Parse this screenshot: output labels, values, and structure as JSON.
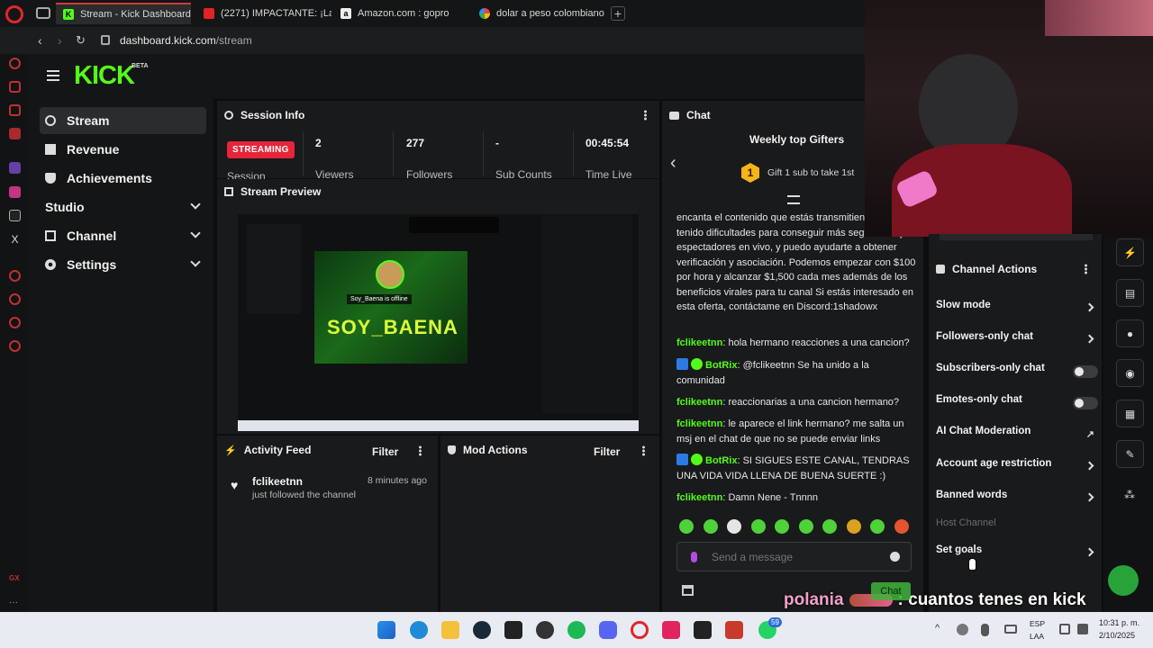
{
  "browser": {
    "tabs": [
      {
        "title": "Stream - Kick Dashboard",
        "active": true
      },
      {
        "title": "(2271) IMPACTANTE: ¡Las"
      },
      {
        "title": "Amazon.com : gopro"
      },
      {
        "title": "dolar a peso colombiano"
      }
    ],
    "url_domain": "dashboard.kick.com",
    "url_path": "/stream"
  },
  "brand": {
    "logo": "KICK",
    "tag": "BETA",
    "accent": "#53fc18"
  },
  "nav": {
    "items": [
      {
        "label": "Stream",
        "icon": "stream-icon"
      },
      {
        "label": "Revenue",
        "icon": "revenue-icon"
      },
      {
        "label": "Achievements",
        "icon": "trophy-icon"
      },
      {
        "label": "Studio",
        "icon": "studio-icon"
      },
      {
        "label": "Channel",
        "icon": "channel-icon"
      },
      {
        "label": "Settings",
        "icon": "gear-icon"
      }
    ]
  },
  "session": {
    "title": "Session Info",
    "badge": "STREAMING",
    "badge_sub": "Session",
    "stats": [
      {
        "value": "2",
        "label": "Viewers"
      },
      {
        "value": "277",
        "label": "Followers"
      },
      {
        "value": "-",
        "label": "Sub Counts"
      },
      {
        "value": "00:45:54",
        "label": "Time Live"
      }
    ]
  },
  "preview": {
    "title": "Stream Preview",
    "offline_text": "Soy_Baena is offline",
    "channel_art": "SOY_BAENA"
  },
  "activity": {
    "title": "Activity Feed",
    "filter": "Filter",
    "items": [
      {
        "user": "fclikeetnn",
        "action": "just followed the channel",
        "time": "8 minutes ago"
      }
    ]
  },
  "mod_actions": {
    "title": "Mod Actions",
    "filter": "Filter"
  },
  "chat": {
    "title": "Chat",
    "gifters_title": "Weekly top Gifters",
    "gifters_rank": "1",
    "gifters_cta": "Gift 1 sub to take 1st",
    "intro_text": "encanta el contenido que estás transmitiendo. Si has tenido dificultades para conseguir más seguidores y espectadores en vivo, y puedo ayudarte a obtener verificación y asociación. Podemos empezar con $100 por hora y alcanzar $1,500 cada mes además de los beneficios virales para tu canal Si estás interesado en esta oferta, contáctame en Discord:1shadowx",
    "messages": [
      {
        "user": "fclikeetnn",
        "text": "hola hermano reacciones a una cancion?"
      },
      {
        "user": "BotRix",
        "text": "@fclikeetnn Se ha unido a la comunidad",
        "bot": true
      },
      {
        "user": "fclikeetnn",
        "text": "reaccionarias a una cancion hermano?"
      },
      {
        "user": "fclikeetnn",
        "text": "le aparece el link hermano? me salta un msj en el chat de que no se puede enviar links"
      },
      {
        "user": "BotRix",
        "text": "SI SIGUES ESTE CANAL, TENDRAS UNA VIDA VIDA LLENA DE BUENA SUERTE :)",
        "bot": true
      },
      {
        "user": "fclikeetnn",
        "text": "Damn Nene - Tnnnn"
      }
    ],
    "input_placeholder": "Send a message",
    "send_label": "Chat"
  },
  "channel_actions": {
    "title": "Channel Actions",
    "items": [
      {
        "label": "Slow mode",
        "control": "arrow"
      },
      {
        "label": "Followers-only chat",
        "control": "arrow"
      },
      {
        "label": "Subscribers-only chat",
        "control": "toggle",
        "on": false
      },
      {
        "label": "Emotes-only chat",
        "control": "toggle",
        "on": false
      },
      {
        "label": "AI Chat Moderation",
        "control": "external"
      },
      {
        "label": "Account age restriction",
        "control": "arrow"
      },
      {
        "label": "Banned words",
        "control": "arrow"
      },
      {
        "label": "Host Channel",
        "control": "none",
        "disabled": true
      },
      {
        "label": "Set goals",
        "control": "arrow"
      }
    ]
  },
  "overlay": {
    "caption_user": "polania",
    "caption_text": ": cuantos tenes en kick"
  },
  "taskbar": {
    "lang": "ESP",
    "region": "LAA",
    "time": "10:31 p. m.",
    "date": "2/10/2025",
    "badge": "59"
  }
}
